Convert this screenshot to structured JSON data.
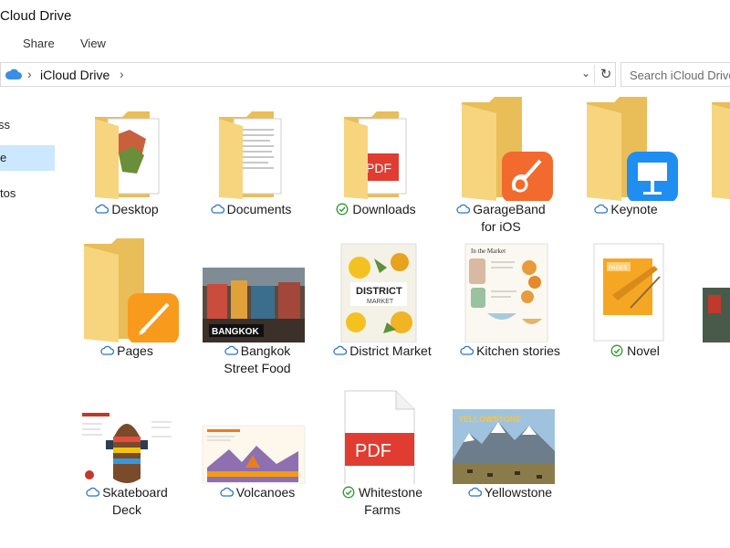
{
  "window": {
    "title": "Cloud Drive"
  },
  "ribbon": {
    "tabs": [
      "Share",
      "View"
    ]
  },
  "address": {
    "location": "iCloud Drive"
  },
  "search": {
    "placeholder": "Search iCloud Drive"
  },
  "sidebar": {
    "items": [
      {
        "label": "ss",
        "selected": false
      },
      {
        "label": "e",
        "selected": true
      },
      {
        "label": "tos",
        "selected": false
      }
    ]
  },
  "colors": {
    "selection": "#cce8ff",
    "folder": "#f6d57e",
    "synced": "#2e9a2e",
    "cloud": "#2a75c9",
    "pdf": "#e03c31"
  },
  "files": [
    {
      "name": "Desktop",
      "status": "cloud",
      "kind": "folder-docs",
      "icon": "folder-icon"
    },
    {
      "name": "Documents",
      "status": "cloud",
      "kind": "folder-docs",
      "icon": "folder-icon"
    },
    {
      "name": "Downloads",
      "status": "synced",
      "kind": "folder-pdf",
      "icon": "folder-icon"
    },
    {
      "name_lines": [
        "GarageBand",
        "for iOS"
      ],
      "status": "cloud",
      "kind": "folder-app",
      "icon": "garageband-app-icon"
    },
    {
      "name": "Keynote",
      "status": "cloud",
      "kind": "folder-app",
      "icon": "keynote-app-icon"
    },
    {
      "name": "Pages",
      "status": "cloud",
      "kind": "folder-app",
      "icon": "pages-app-icon"
    },
    {
      "name_lines": [
        "Bangkok",
        "Street Food"
      ],
      "status": "cloud",
      "kind": "photo",
      "thumb_text": "BANGKOK"
    },
    {
      "name": "District Market",
      "status": "cloud",
      "kind": "document",
      "thumb_text": [
        "DISTRICT",
        "MARKET"
      ]
    },
    {
      "name": "Kitchen stories",
      "status": "cloud",
      "kind": "document",
      "thumb_text": "In the Market"
    },
    {
      "name": "Novel",
      "status": "synced",
      "kind": "pages-doc",
      "thumb_text": "PAGES"
    },
    {
      "name_lines": [
        "Skateboard",
        "Deck"
      ],
      "status": "cloud",
      "kind": "document"
    },
    {
      "name": "Volcanoes",
      "status": "cloud",
      "kind": "document"
    },
    {
      "name_lines": [
        "Whitestone",
        "Farms"
      ],
      "status": "synced",
      "kind": "pdf",
      "thumb_text": "PDF"
    },
    {
      "name": "Yellowstone",
      "status": "cloud",
      "kind": "photo",
      "thumb_text": "YELLOWSTONE"
    }
  ]
}
